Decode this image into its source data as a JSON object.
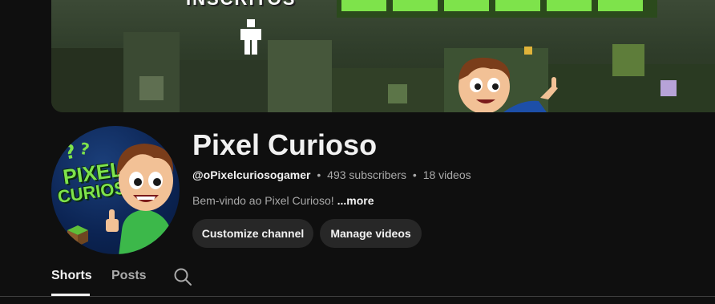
{
  "banner": {
    "text": "INSCRITOS",
    "figure_icon": "person-icon",
    "mascot_icon": "pointing-boy-icon"
  },
  "avatar": {
    "text_line1": "PIXEL",
    "text_line2": "CURIOSO",
    "icon": "channel-avatar"
  },
  "channel": {
    "name": "Pixel Curioso",
    "handle": "@oPixelcuriosogamer",
    "separator": "•",
    "subscribers": "493 subscribers",
    "videos": "18 videos",
    "description": "Bem-vindo ao Pixel Curioso!",
    "more_label": "...more"
  },
  "actions": {
    "customize_label": "Customize channel",
    "manage_label": "Manage videos"
  },
  "tabs": [
    {
      "label": "Shorts",
      "selected": true
    },
    {
      "label": "Posts",
      "selected": false
    }
  ],
  "search_icon": "search-icon",
  "colors": {
    "background": "#0f0f0f",
    "button_bg": "#272727",
    "text_primary": "#f1f1f1",
    "text_secondary": "#aaaaaa",
    "accent_green": "#7ee34b"
  }
}
